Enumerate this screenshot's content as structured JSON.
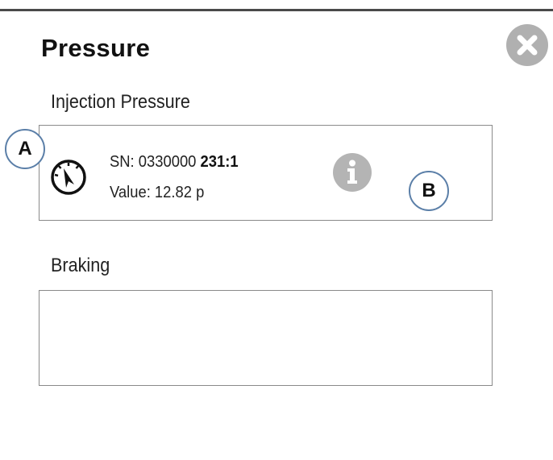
{
  "dialog": {
    "title": "Pressure",
    "close_icon": "close-x-icon"
  },
  "sections": [
    {
      "label": "Injection Pressure",
      "sensor": {
        "icon": "pressure-gauge-icon",
        "sn_prefix": "SN: 0330000",
        "sn_suffix": "231:1",
        "value_text": "Value: 12.82 p",
        "info_icon": "info-icon"
      }
    },
    {
      "label": "Braking"
    }
  ],
  "callouts": [
    "A",
    "B"
  ],
  "colors": {
    "icon_gray": "#b0b0b0",
    "callout_border": "#5b7fa8",
    "panel_border": "#8a8a8a"
  }
}
